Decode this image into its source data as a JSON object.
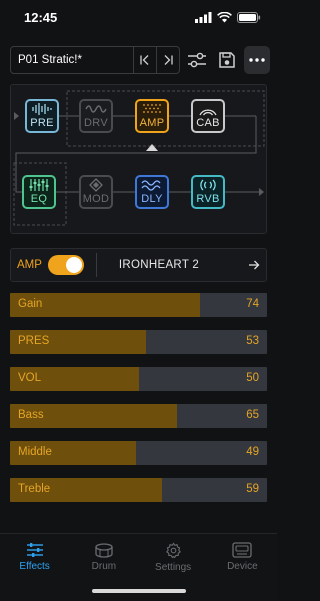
{
  "status": {
    "time": "12:45"
  },
  "preset": {
    "name": "P01  Stratic!*"
  },
  "chain": {
    "row1": [
      {
        "label": "PRE",
        "icon": "preamp-icon",
        "state": "active"
      },
      {
        "label": "DRV",
        "icon": "drive-wave-icon",
        "state": "bypassed"
      },
      {
        "label": "AMP",
        "icon": "amp-grille-icon",
        "state": "selected"
      },
      {
        "label": "CAB",
        "icon": "cabinet-icon",
        "state": "active"
      }
    ],
    "row2": [
      {
        "label": "EQ",
        "icon": "eq-sliders-icon",
        "state": "active"
      },
      {
        "label": "MOD",
        "icon": "mod-diamond-icon",
        "state": "bypassed"
      },
      {
        "label": "DLY",
        "icon": "delay-wave-icon",
        "state": "active"
      },
      {
        "label": "RVB",
        "icon": "reverb-wave-icon",
        "state": "active"
      }
    ]
  },
  "amp": {
    "label": "AMP",
    "enabled": true,
    "model": "IRONHEART 2"
  },
  "params": [
    {
      "name": "Gain",
      "value": "74"
    },
    {
      "name": "PRES",
      "value": "53"
    },
    {
      "name": "VOL",
      "value": "50"
    },
    {
      "name": "Bass",
      "value": "65"
    },
    {
      "name": "Middle",
      "value": "49"
    },
    {
      "name": "Treble",
      "value": "59"
    }
  ],
  "tabs": [
    {
      "label": "Effects",
      "icon": "sliders-icon",
      "active": true
    },
    {
      "label": "Drum",
      "icon": "drum-icon",
      "active": false
    },
    {
      "label": "Settings",
      "icon": "gear-icon",
      "active": false
    },
    {
      "label": "Device",
      "icon": "device-icon",
      "active": false
    }
  ],
  "colors": {
    "accent": "#f0a31c",
    "tab_active": "#2ea3f2",
    "param_fill": "#6e4f0c",
    "param_track": "#34373d"
  }
}
